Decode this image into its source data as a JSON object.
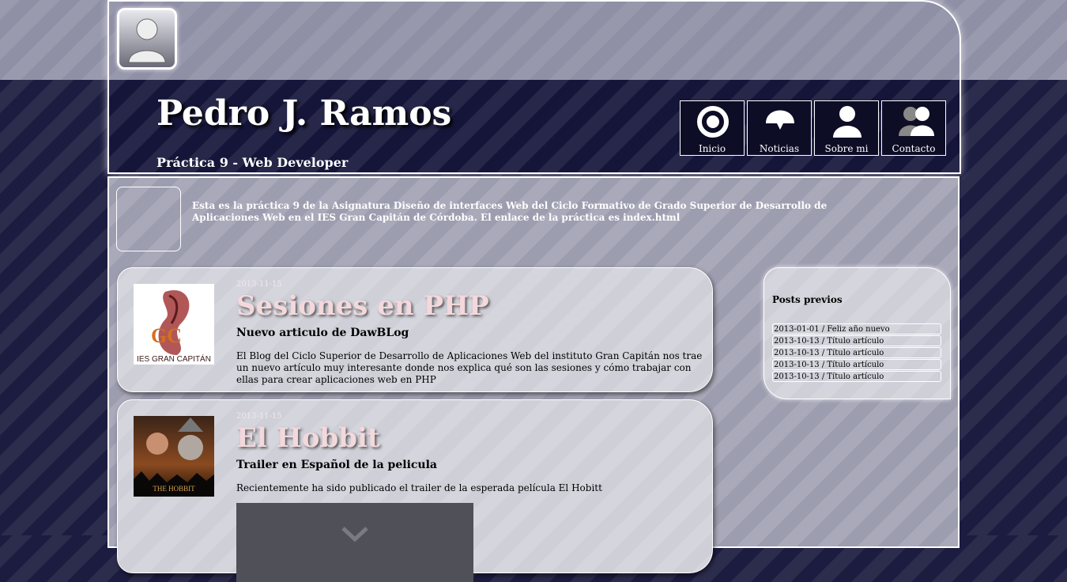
{
  "header": {
    "title": "Pedro J. Ramos",
    "subtitle": "Práctica 9 - Web Developer"
  },
  "nav": {
    "items": [
      {
        "label": "Inicio",
        "icon": "target-icon"
      },
      {
        "label": "Noticias",
        "icon": "dome-icon"
      },
      {
        "label": "Sobre mi",
        "icon": "user-icon"
      },
      {
        "label": "Contacto",
        "icon": "users-icon"
      }
    ]
  },
  "intro": {
    "text": "Esta es la práctica 9 de la Asignatura Diseño de interfaces Web del Ciclo Formativo de Grado Superior de Desarrollo de Aplicaciones Web en el IES Gran Capitán de Córdoba. El enlace de la práctica es index.html"
  },
  "posts": [
    {
      "date": "2013-11-15",
      "title": "Sesiones en PHP",
      "subtitle": "Nuevo articulo de DawBLog",
      "body": "El Blog del Ciclo Superior de Desarrollo de Aplicaciones Web del instituto Gran Capitán nos trae un nuevo artículo muy interesante donde nos explica qué son las sesiones y cómo trabajar con ellas para crear aplicaciones web en PHP",
      "thumb_text": "IES GRAN CAPITÁN",
      "thumb_logo": "GC"
    },
    {
      "date": "2013-11-15",
      "title": "El Hobbit",
      "subtitle": "Trailer en Español de la pelicula",
      "body": "Recientemente ha sido publicado el trailer de la esperada película El Hobitt",
      "thumb_text": "THE HOBBIT"
    }
  ],
  "sidebar": {
    "title": "Posts previos",
    "items": [
      "2013-01-01 / Feliz año nuevo",
      "2013-10-13 / Título artículo",
      "2013-10-13 / Título artículo",
      "2013-10-13 / Título artículo",
      "2013-10-13 / Título artículo"
    ]
  }
}
